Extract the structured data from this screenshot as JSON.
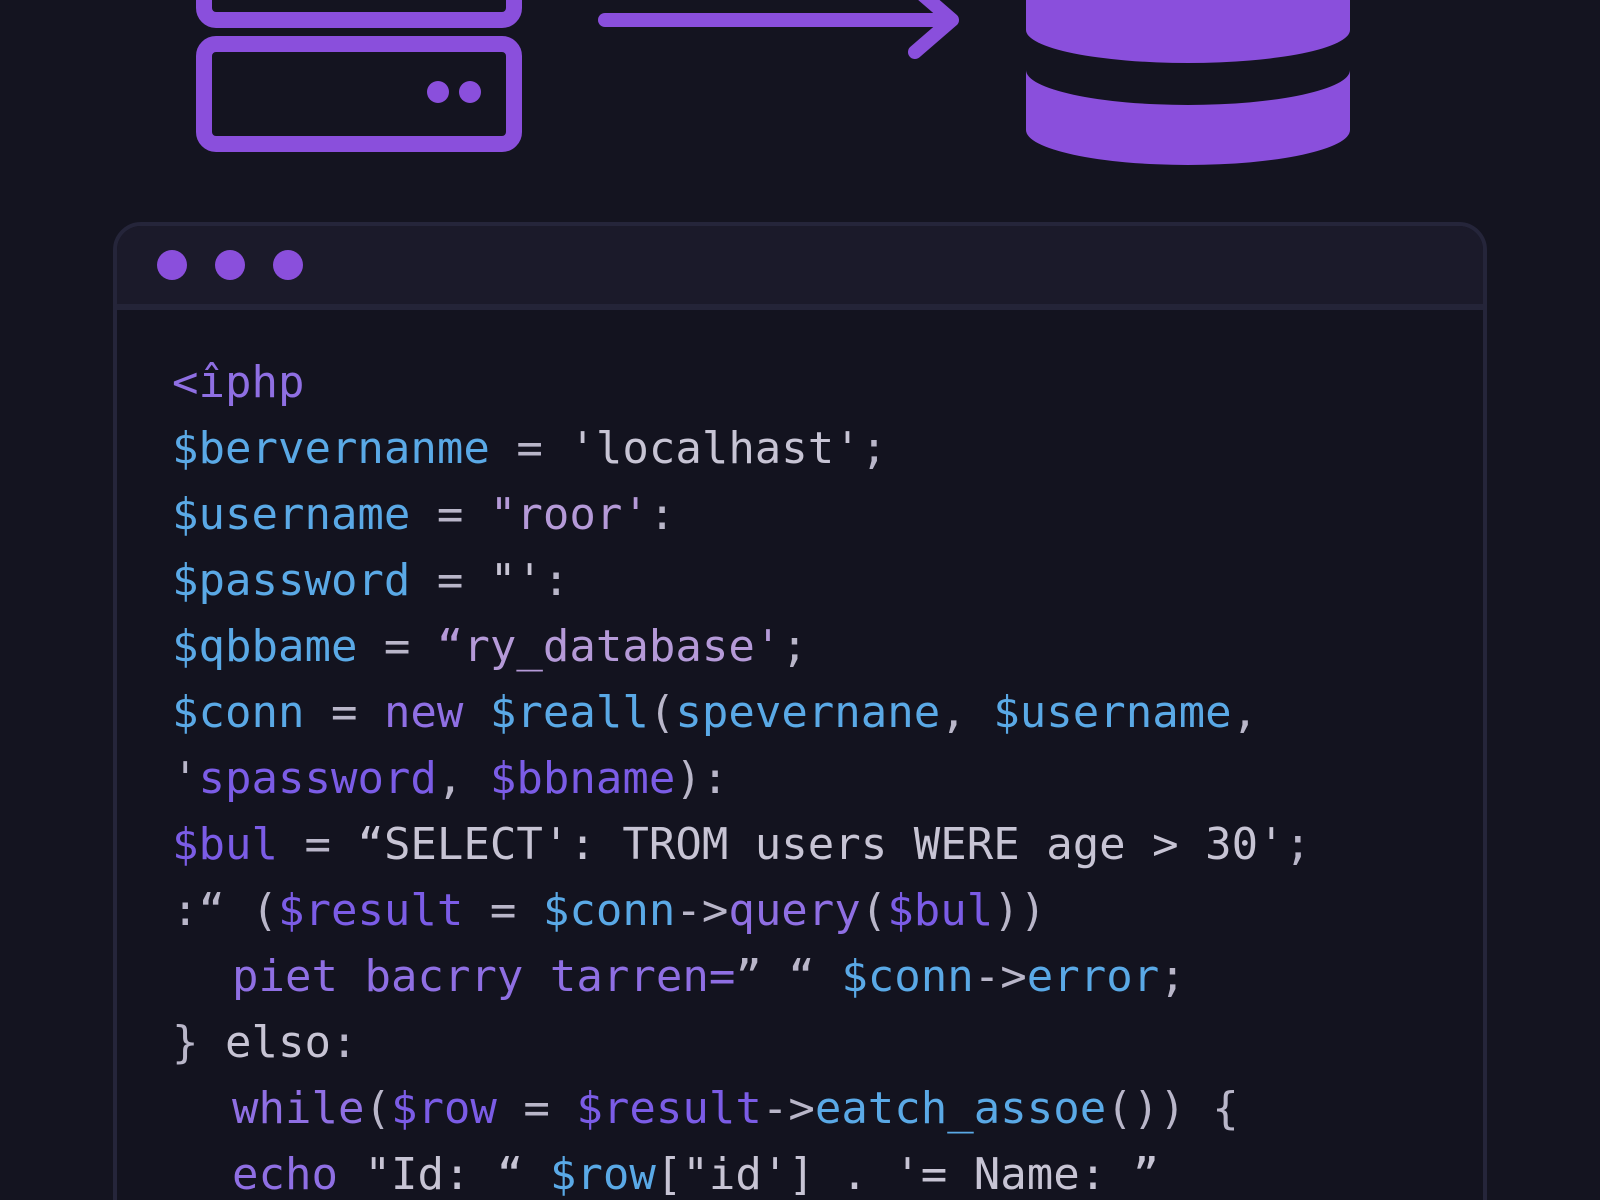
{
  "colors": {
    "accent": "#8a4fdc",
    "background": "#141420",
    "window_background": "#13131f",
    "titlebar_background": "#1b1a2a",
    "variable": "#5aa9e6",
    "keyword": "#8f6fe3",
    "string": "#b59ad8",
    "text": "#c7c4d4"
  },
  "illustration": {
    "icons": [
      "server-icon",
      "arrow-right-icon",
      "database-icon"
    ]
  },
  "window": {
    "controls": [
      "window-dot",
      "window-dot",
      "window-dot"
    ]
  },
  "code": {
    "lines": [
      {
        "indent": false,
        "tokens": [
          {
            "t": "<îphp",
            "c": "kw"
          }
        ]
      },
      {
        "indent": false,
        "tokens": [
          {
            "t": "$bervernanme",
            "c": "var"
          },
          {
            "t": " = ",
            "c": "op"
          },
          {
            "t": "'localhast'",
            "c": "txt"
          },
          {
            "t": ";",
            "c": "op"
          }
        ]
      },
      {
        "indent": false,
        "tokens": [
          {
            "t": "$username",
            "c": "var"
          },
          {
            "t": " = ",
            "c": "op"
          },
          {
            "t": "\"roor'",
            "c": "str"
          },
          {
            "t": ":",
            "c": "op"
          }
        ]
      },
      {
        "indent": false,
        "tokens": [
          {
            "t": "$password",
            "c": "var"
          },
          {
            "t": " = ",
            "c": "op"
          },
          {
            "t": "\"'",
            "c": "txt"
          },
          {
            "t": ":",
            "c": "op"
          }
        ]
      },
      {
        "indent": false,
        "tokens": [
          {
            "t": "$qbbame",
            "c": "var"
          },
          {
            "t": " = ",
            "c": "op"
          },
          {
            "t": "“ry_database'",
            "c": "str"
          },
          {
            "t": ";",
            "c": "op"
          }
        ]
      },
      {
        "indent": false,
        "tokens": [
          {
            "t": "$conn",
            "c": "var"
          },
          {
            "t": " = ",
            "c": "op"
          },
          {
            "t": "new ",
            "c": "kw"
          },
          {
            "t": "$reall",
            "c": "var"
          },
          {
            "t": "(",
            "c": "op"
          },
          {
            "t": "spevernane",
            "c": "var"
          },
          {
            "t": ", ",
            "c": "op"
          },
          {
            "t": "$username",
            "c": "var"
          },
          {
            "t": ",",
            "c": "op"
          }
        ]
      },
      {
        "indent": false,
        "tokens": [
          {
            "t": "'",
            "c": "op"
          },
          {
            "t": "spassword",
            "c": "var2"
          },
          {
            "t": ", ",
            "c": "op"
          },
          {
            "t": "$bbname",
            "c": "var2"
          },
          {
            "t": "):",
            "c": "op"
          }
        ]
      },
      {
        "indent": false,
        "tokens": [
          {
            "t": "$bul",
            "c": "var2"
          },
          {
            "t": " = ",
            "c": "op"
          },
          {
            "t": "“SELECT': TROM users WERE age > 30'",
            "c": "txt"
          },
          {
            "t": ";",
            "c": "op"
          }
        ]
      },
      {
        "indent": false,
        "tokens": [
          {
            "t": ":“ (",
            "c": "op"
          },
          {
            "t": "$result",
            "c": "var2"
          },
          {
            "t": " = ",
            "c": "op"
          },
          {
            "t": "$conn",
            "c": "var"
          },
          {
            "t": "->",
            "c": "op"
          },
          {
            "t": "query",
            "c": "kw"
          },
          {
            "t": "(",
            "c": "op"
          },
          {
            "t": "$bul",
            "c": "var2"
          },
          {
            "t": "))",
            "c": "op"
          }
        ]
      },
      {
        "indent": true,
        "tokens": [
          {
            "t": "piet",
            "c": "kw"
          },
          {
            "t": " ",
            "c": "op"
          },
          {
            "t": "bacrry tarren=",
            "c": "kw"
          },
          {
            "t": "” “ ",
            "c": "op"
          },
          {
            "t": "$conn",
            "c": "var"
          },
          {
            "t": "->",
            "c": "op"
          },
          {
            "t": "error",
            "c": "var"
          },
          {
            "t": ";",
            "c": "op"
          }
        ]
      },
      {
        "indent": false,
        "tokens": [
          {
            "t": "} ",
            "c": "op"
          },
          {
            "t": "elso",
            "c": "txt"
          },
          {
            "t": ":",
            "c": "op"
          }
        ]
      },
      {
        "indent": true,
        "tokens": [
          {
            "t": "while",
            "c": "kw"
          },
          {
            "t": "(",
            "c": "op"
          },
          {
            "t": "$row",
            "c": "var2"
          },
          {
            "t": " = ",
            "c": "op"
          },
          {
            "t": "$result",
            "c": "var2"
          },
          {
            "t": "->",
            "c": "op"
          },
          {
            "t": "eatch_assoe",
            "c": "var"
          },
          {
            "t": "()) {",
            "c": "op"
          }
        ]
      },
      {
        "indent": true,
        "tokens": [
          {
            "t": "echo",
            "c": "kw"
          },
          {
            "t": " \"Id: “ ",
            "c": "txt"
          },
          {
            "t": "$row",
            "c": "var"
          },
          {
            "t": "[\"id'] . '= Name: ”",
            "c": "txt"
          }
        ]
      }
    ]
  }
}
